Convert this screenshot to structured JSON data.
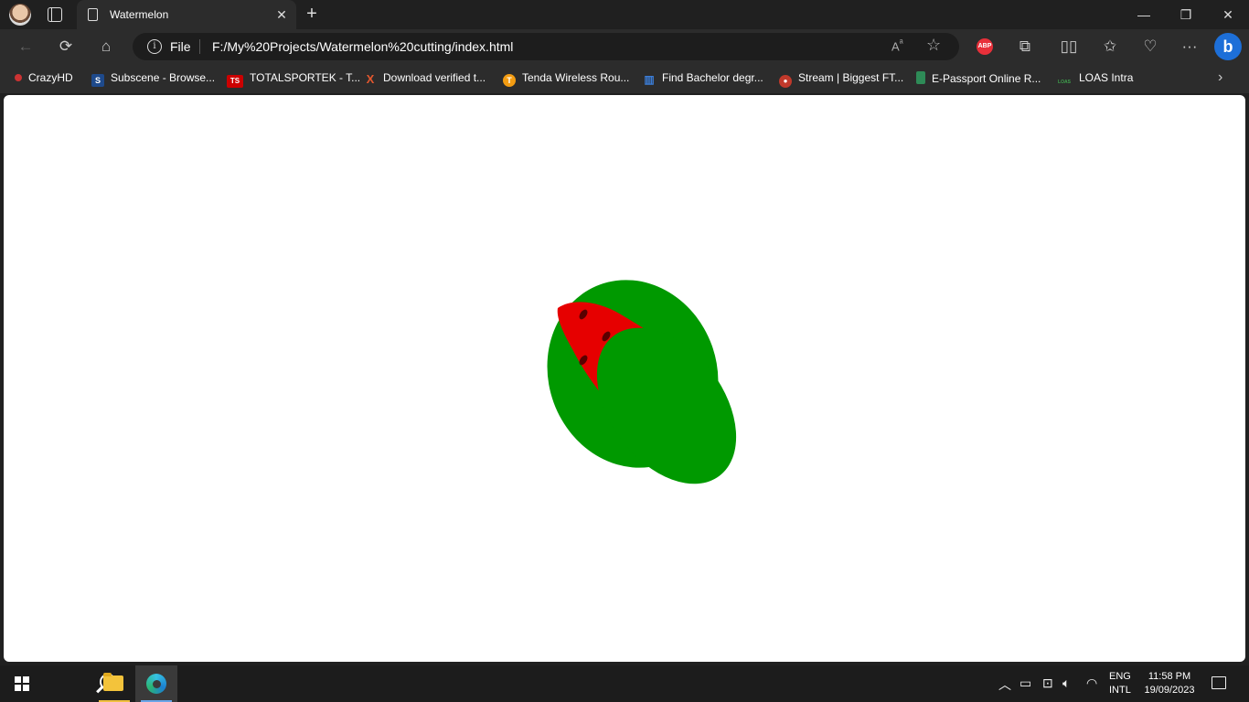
{
  "browser": {
    "tab": {
      "title": "Watermelon"
    },
    "address": {
      "scheme_label": "File",
      "url": "F:/My%20Projects/Watermelon%20cutting/index.html"
    },
    "window_controls": {
      "minimize": "—",
      "maximize": "❐",
      "close": "✕"
    }
  },
  "bookmarks": [
    {
      "label": "CrazyHD",
      "icon": "crazyhd-icon",
      "color": "#d33"
    },
    {
      "label": "Subscene - Browse...",
      "icon": "subscene-icon",
      "glyph": "S",
      "color": "#1e4a8c"
    },
    {
      "label": "TOTALSPORTEK - T...",
      "icon": "totalsportek-icon",
      "glyph": "TS",
      "color": "#c00"
    },
    {
      "label": "Download verified t...",
      "icon": "x-download-icon",
      "glyph": "X",
      "color": "#e4572e"
    },
    {
      "label": "Tenda Wireless Rou...",
      "icon": "tenda-icon",
      "glyph": "T",
      "color": "#f39c12"
    },
    {
      "label": "Find Bachelor degr...",
      "icon": "university-icon",
      "glyph": "▥",
      "color": "#3b7dd8"
    },
    {
      "label": "Stream | Biggest FT...",
      "icon": "stream-icon",
      "glyph": "⚽",
      "color": "#c0392b"
    },
    {
      "label": "E-Passport Online R...",
      "icon": "passport-icon",
      "glyph": "▮",
      "color": "#2e8b57"
    },
    {
      "label": "LOAS Intra",
      "icon": "loas-icon",
      "glyph": "LOAS",
      "color": "#3fa34d"
    }
  ],
  "page": {
    "background": "#ffffff",
    "watermelon": {
      "rind_color": "#009900",
      "flesh_color": "#e60000",
      "seed_color": "#5a0000"
    }
  },
  "taskbar": {
    "language": {
      "line1": "ENG",
      "line2": "INTL"
    },
    "clock": {
      "time": "11:58 PM",
      "date": "19/09/2023"
    }
  }
}
